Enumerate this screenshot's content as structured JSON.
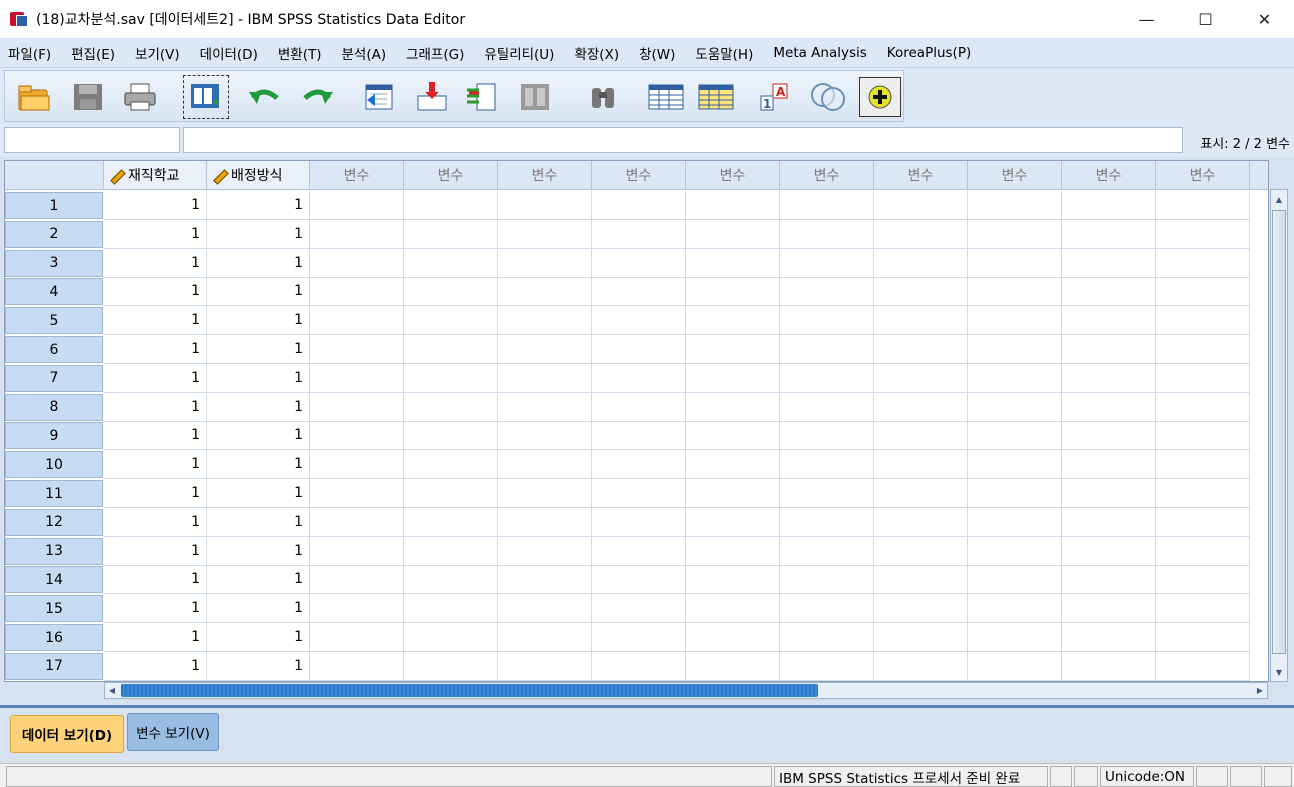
{
  "window": {
    "title": "(18)교차분석.sav [데이터세트2] - IBM SPSS Statistics Data Editor",
    "controls": {
      "minimize": "—",
      "maximize": "☐",
      "close": "✕"
    }
  },
  "menu": [
    "파일(F)",
    "편집(E)",
    "보기(V)",
    "데이터(D)",
    "변환(T)",
    "분석(A)",
    "그래프(G)",
    "유틸리티(U)",
    "확장(X)",
    "창(W)",
    "도움말(H)",
    "Meta Analysis",
    "KoreaPlus(P)"
  ],
  "toolbar": {
    "icons": [
      "open-folder-icon",
      "save-icon",
      "print-icon",
      "recall-dialog-icon",
      "undo-icon",
      "redo-icon",
      "goto-case-icon",
      "goto-variable-icon",
      "variables-icon",
      "run-descriptives-icon",
      "find-icon",
      "insert-cases-icon",
      "insert-variable-icon",
      "split-file-icon",
      "weight-cases-icon",
      "select-cases-icon",
      "value-labels-icon",
      "use-sets-icon",
      "show-all-icon"
    ]
  },
  "cellbar": {
    "cell_ref": "",
    "cell_value": "",
    "show_label": "표시: 2 / 2 변수"
  },
  "grid": {
    "columns": [
      "재직학교",
      "배정방식",
      "변수",
      "변수",
      "변수",
      "변수",
      "변수",
      "변수",
      "변수",
      "변수",
      "변수",
      "변수"
    ],
    "rows": [
      {
        "n": "1",
        "v": [
          "1",
          "1"
        ]
      },
      {
        "n": "2",
        "v": [
          "1",
          "1"
        ]
      },
      {
        "n": "3",
        "v": [
          "1",
          "1"
        ]
      },
      {
        "n": "4",
        "v": [
          "1",
          "1"
        ]
      },
      {
        "n": "5",
        "v": [
          "1",
          "1"
        ]
      },
      {
        "n": "6",
        "v": [
          "1",
          "1"
        ]
      },
      {
        "n": "7",
        "v": [
          "1",
          "1"
        ]
      },
      {
        "n": "8",
        "v": [
          "1",
          "1"
        ]
      },
      {
        "n": "9",
        "v": [
          "1",
          "1"
        ]
      },
      {
        "n": "10",
        "v": [
          "1",
          "1"
        ]
      },
      {
        "n": "11",
        "v": [
          "1",
          "1"
        ]
      },
      {
        "n": "12",
        "v": [
          "1",
          "1"
        ]
      },
      {
        "n": "13",
        "v": [
          "1",
          "1"
        ]
      },
      {
        "n": "14",
        "v": [
          "1",
          "1"
        ]
      },
      {
        "n": "15",
        "v": [
          "1",
          "1"
        ]
      },
      {
        "n": "16",
        "v": [
          "1",
          "1"
        ]
      },
      {
        "n": "17",
        "v": [
          "1",
          "1"
        ]
      }
    ]
  },
  "tabs": {
    "data_view": "데이터 보기(D)",
    "variable_view": "변수 보기(V)"
  },
  "status": {
    "processor": "IBM SPSS Statistics 프로세서 준비 완료",
    "unicode": "Unicode:ON"
  }
}
